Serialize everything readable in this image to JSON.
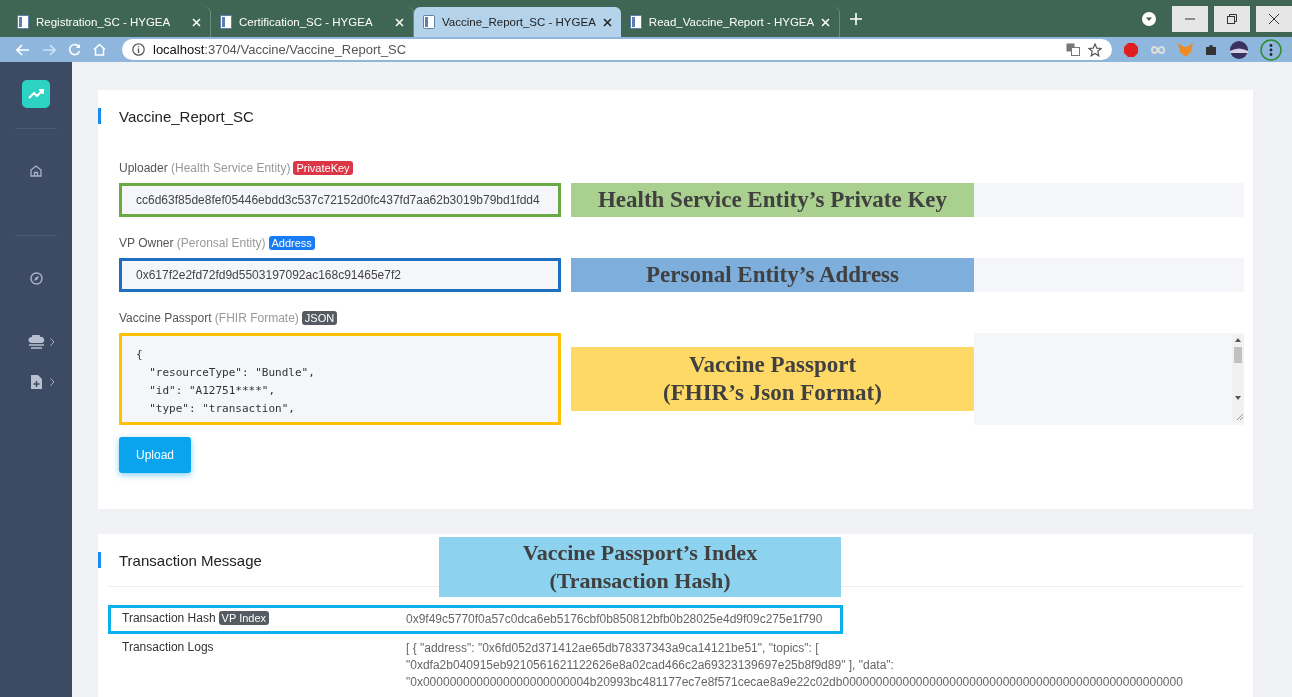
{
  "browser": {
    "tabs": [
      {
        "title": "Registration_SC - HYGEA",
        "selected": false
      },
      {
        "title": "Certification_SC - HYGEA",
        "selected": false
      },
      {
        "title": "Vaccine_Report_SC - HYGEA",
        "selected": true
      },
      {
        "title": "Read_Vaccine_Report - HYGEA",
        "selected": false
      }
    ],
    "url_host": "localhost",
    "url_path": ":3704/Vaccine/Vaccine_Report_SC"
  },
  "sidebar": {
    "items": [
      {
        "expandable": false
      },
      {
        "expandable": false
      },
      {
        "expandable": true
      },
      {
        "expandable": true
      }
    ]
  },
  "report_card": {
    "title": "Vaccine_Report_SC",
    "fields": [
      {
        "kind": "input",
        "label": "Uploader",
        "hint": "(Health Service Entity)",
        "badge": {
          "text": "PrivateKey",
          "color": "#dc3545"
        },
        "value": "cc6d63f85de8fef05446ebdd3c537c72152d0fc437fd7aa62b3019b79bd1fdd4",
        "outline": {
          "color": "#6aaa46"
        },
        "annotation": {
          "lines": [
            "Health Service Entity’s Private Key"
          ],
          "color": "#a9d08e"
        }
      },
      {
        "kind": "input",
        "label": "VP Owner",
        "hint": "(Peronsal Entity)",
        "badge": {
          "text": "Address",
          "color": "#1a7cf5"
        },
        "value": "0x617f2e2fd72fd9d5503197092ac168c91465e7f2",
        "outline": {
          "color": "#1f6fbf"
        },
        "annotation": {
          "lines": [
            "Personal Entity’s Address"
          ],
          "color": "#7eaedc"
        }
      },
      {
        "kind": "textarea",
        "label": "Vaccine Passport",
        "hint": "(FHIR Formate)",
        "badge": {
          "text": "JSON",
          "color": "#555b63"
        },
        "lines": [
          "{",
          "  \"resourceType\": \"Bundle\",",
          "  \"id\": \"A12751****\",",
          "  \"type\": \"transaction\","
        ],
        "outline": {
          "color": "#ffc000"
        },
        "annotation": {
          "lines": [
            "Vaccine Passport",
            "(FHIR’s Json Format)"
          ],
          "color": "#ffd966"
        }
      }
    ],
    "button": "Upload"
  },
  "transaction_card": {
    "title": "Transaction Message",
    "annotation": [
      "Vaccine Passport’s Index",
      "(Transaction Hash)"
    ],
    "rows": [
      {
        "label": "Transaction Hash",
        "badge": "VP Index",
        "outlined": true,
        "lines": [
          "0x9f49c5770f0a57c0dca6eb5176cbf0b850812bfb0b28025e4d9f09c275e1f790"
        ]
      },
      {
        "label": "Transaction Logs",
        "outlined": false,
        "lines": [
          "[ { \"address\": \"0x6fd052d371412ae65db78337343a9ca14121be51\", \"topics\": [",
          "\"0xdfa2b040915eb9210561621122626e8a02cad466c2a69323139697e25b8f9d89\" ], \"data\":",
          "\"0x0000000000000000000000004b20993bc481177ec7e8f571cecae8a9e22c02db000000000000000000000000000000000000000000000000000"
        ]
      }
    ]
  }
}
